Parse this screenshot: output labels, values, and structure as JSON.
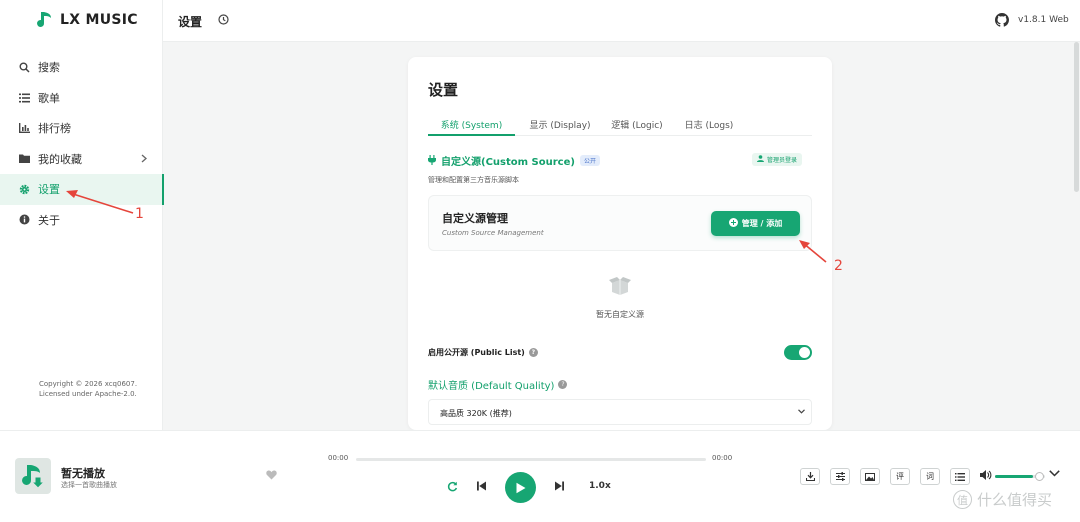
{
  "app": {
    "logo_text": "LX MUSIC",
    "version": "v1.8.1 Web",
    "accent": "#17a673"
  },
  "sidebar": {
    "items": [
      {
        "label": "搜索",
        "icon": "search-icon"
      },
      {
        "label": "歌单",
        "icon": "list-icon"
      },
      {
        "label": "排行榜",
        "icon": "chart-icon"
      },
      {
        "label": "我的收藏",
        "icon": "folder-icon"
      },
      {
        "label": "设置",
        "icon": "gear-icon",
        "active": true
      },
      {
        "label": "关于",
        "icon": "info-icon"
      }
    ],
    "copyright_line1": "Copyright © 2026 xcq0607.",
    "copyright_line2": "Licensed under Apache-2.0."
  },
  "header": {
    "title": "设置"
  },
  "settings": {
    "title": "设置",
    "tabs": [
      {
        "label": "系统 (System)",
        "active": true
      },
      {
        "label": "显示 (Display)"
      },
      {
        "label": "逻辑 (Logic)"
      },
      {
        "label": "日志 (Logs)"
      }
    ],
    "custom_source": {
      "title": "自定义源(Custom Source)",
      "badge": "公开",
      "admin_label": "管理员登录",
      "description": "管理和配置第三方音乐源脚本",
      "card_title": "自定义源管理",
      "card_subtitle": "Custom Source Management",
      "manage_button": "管理 / 添加",
      "empty_text": "暂无自定义源"
    },
    "public_list_label": "启用公开源 (Public List)",
    "public_list_enabled": true,
    "quality_label": "默认音质 (Default Quality)",
    "quality_value": "高品质 320K (推荐)"
  },
  "annotations": {
    "marker1": "1",
    "marker2": "2",
    "color": "#e5453b"
  },
  "player": {
    "title": "暂无播放",
    "subtitle": "选择一首歌曲播放",
    "time_current": "00:00",
    "time_total": "00:00",
    "progress": 0,
    "speed": "1.0x",
    "tools": [
      "download-icon",
      "equalizer-icon",
      "image-icon",
      "评",
      "词",
      "playlist-icon"
    ],
    "volume": 0.75
  },
  "watermark": {
    "circle_char": "值",
    "text": "什么值得买"
  }
}
